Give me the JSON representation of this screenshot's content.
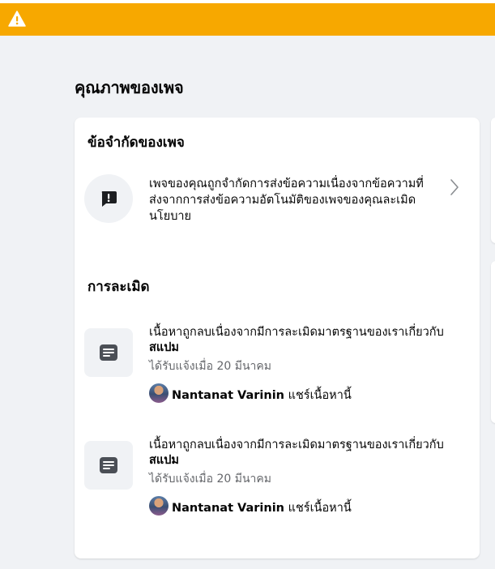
{
  "page_title": "คุณภาพของเพจ",
  "limits": {
    "title": "ข้อจำกัดของเพจ",
    "items": [
      {
        "text": "เพจของคุณถูกจำกัดการส่งข้อความเนื่องจากข้อความที่ส่งจากการส่งข้อความอัตโนมัติของเพจของคุณละเมิดนโยบาย",
        "icon": "message-alert-icon"
      }
    ]
  },
  "violations": {
    "title": "การละเมิด",
    "items": [
      {
        "text_prefix": "เนื้อหาถูกลบเนื่องจากมีการละเมิดมาตรฐานของเราเกี่ยวกับ",
        "text_bold": "สแปม",
        "date": "ได้รับแจ้งเมื่อ 20 มีนาคม",
        "sharer_name": "Nantanat Varinin",
        "sharer_action": "แชร์เนื้อหานี้",
        "icon": "post-icon"
      },
      {
        "text_prefix": "เนื้อหาถูกลบเนื่องจากมีการละเมิดมาตรฐานของเราเกี่ยวกับ",
        "text_bold": "สแปม",
        "date": "ได้รับแจ้งเมื่อ 20 มีนาคม",
        "sharer_name": "Nantanat Varinin",
        "sharer_action": "แชร์เนื้อหานี้",
        "icon": "post-icon"
      }
    ]
  },
  "colors": {
    "warning_bar": "#f7a800",
    "background": "#f0f2f5",
    "card": "#ffffff",
    "secondary_text": "#65676b"
  }
}
